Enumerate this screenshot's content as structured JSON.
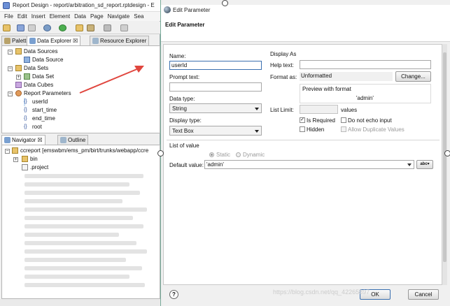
{
  "ide": {
    "title": "Report Design - report/arbitration_sd_report.rptdesign - E",
    "menu": [
      "File",
      "Edit",
      "Insert",
      "Element",
      "Data",
      "Page",
      "Navigate",
      "Sea"
    ],
    "top_tabs": [
      {
        "label": "Palette"
      },
      {
        "label": "Data Explorer ☒"
      },
      {
        "label": "Resource Explorer"
      }
    ],
    "data_tree": [
      {
        "label": "Data Sources",
        "level": 0,
        "expander": "-",
        "icon": "datasource-folder-icon"
      },
      {
        "label": "Data Source",
        "level": 1,
        "expander": "",
        "icon": "datasource-icon"
      },
      {
        "label": "Data Sets",
        "level": 0,
        "expander": "-",
        "icon": "dataset-folder-icon"
      },
      {
        "label": "Data Set",
        "level": 1,
        "expander": "+",
        "icon": "dataset-icon"
      },
      {
        "label": "Data Cubes",
        "level": 0,
        "expander": "",
        "icon": "cube-icon"
      },
      {
        "label": "Report Parameters",
        "level": 0,
        "expander": "-",
        "icon": "parameters-icon"
      },
      {
        "label": "userId",
        "level": 1,
        "expander": "",
        "icon": "param-icon"
      },
      {
        "label": "start_time",
        "level": 1,
        "expander": "",
        "icon": "param-icon"
      },
      {
        "label": "end_time",
        "level": 1,
        "expander": "",
        "icon": "param-icon"
      },
      {
        "label": "root",
        "level": 1,
        "expander": "",
        "icon": "param-icon"
      }
    ],
    "bottom_tabs": [
      {
        "label": "Navigator ☒"
      },
      {
        "label": "Outline"
      }
    ],
    "nav_tree": [
      {
        "label": "ccreport [emswbm/ems_pm/birt/trunks/webapp/ccre",
        "level": 0
      },
      {
        "label": "bin",
        "level": 1
      },
      {
        "label": ".project",
        "level": 1
      }
    ]
  },
  "dialog": {
    "title": "Edit Parameter",
    "heading": "Edit Parameter",
    "name_label": "Name:",
    "name_value": "userId",
    "prompt_label": "Prompt text:",
    "prompt_value": "",
    "datatype_label": "Data type:",
    "datatype_value": "String",
    "displaytype_label": "Display type:",
    "displaytype_value": "Text Box",
    "display_as_label": "Display As",
    "help_label": "Help text:",
    "help_value": "",
    "format_label": "Format as:",
    "format_value": "Unformatted",
    "change_button": "Change...",
    "preview_label": "Preview with format",
    "preview_value": "'admin'",
    "list_limit_label": "List Limit:",
    "list_limit_value": "",
    "values_label": "values",
    "is_required_label": "Is Required",
    "is_required_checked": true,
    "do_not_echo_label": "Do not echo input",
    "hidden_label": "Hidden",
    "allow_duplicate_label": "Allow Duplicate Values",
    "list_of_value_label": "List of value",
    "static_label": "Static",
    "dynamic_label": "Dynamic",
    "default_value_label": "Default value:",
    "default_value": "'admin'",
    "expr_button": "abc",
    "help_icon_label": "?",
    "ok_button": "OK",
    "cancel_button": "Cancel"
  },
  "watermark": "https://blog.csdn.net/qq_42265897",
  "colors": {
    "arrow": "#e0463e",
    "selection": "#cfe3f7",
    "accent": "#3a6fb0"
  }
}
